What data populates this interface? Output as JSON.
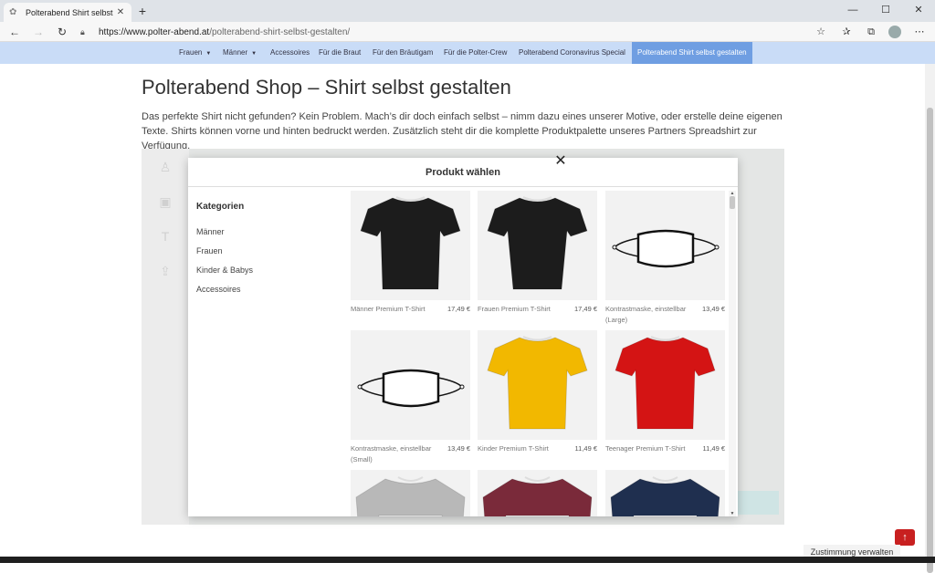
{
  "browser": {
    "tab_title": "Polterabend Shirt selbst gestalten",
    "new_tab": "+",
    "url_domain": "https://www.polter-abend.at",
    "url_path": "/polterabend-shirt-selbst-gestalten/"
  },
  "sitenav": {
    "items": [
      "Frauen",
      "Männer",
      "Accessoires",
      "Für die Braut",
      "Für den Bräutigam",
      "Für die Polter-Crew",
      "Polterabend Coronavirus Special",
      "Polterabend Shirt selbst gestalten"
    ]
  },
  "page": {
    "title": "Polterabend Shop – Shirt selbst gestalten",
    "intro": "Das perfekte Shirt nicht gefunden? Kein Problem. Mach’s dir doch einfach selbst – nimm dazu eines unserer Motive, oder erstelle deine eigenen Texte. Shirts können vorne und hinten bedruckt werden. Zusätzlich steht dir die komplette Produktpalette unseres Partners Spreadshirt zur Verfügung."
  },
  "modal": {
    "title": "Produkt wählen",
    "categories_heading": "Kategorien",
    "categories": [
      "Männer",
      "Frauen",
      "Kinder & Babys",
      "Accessoires"
    ],
    "products": [
      {
        "name": "Männer Premium T-Shirt",
        "price": "17,49 €",
        "kind": "tshirt",
        "color": "#1c1c1c"
      },
      {
        "name": "Frauen Premium T-Shirt",
        "price": "17,49 €",
        "kind": "tshirt-women",
        "color": "#1c1c1c"
      },
      {
        "name": "Kontrastmaske, einstellbar (Large)",
        "price": "13,49 €",
        "kind": "mask",
        "color": "#ffffff"
      },
      {
        "name": "Kontrastmaske, einstellbar (Small)",
        "price": "13,49 €",
        "kind": "mask",
        "color": "#ffffff"
      },
      {
        "name": "Kinder Premium T-Shirt",
        "price": "11,49 €",
        "kind": "tshirt",
        "color": "#f2b800"
      },
      {
        "name": "Teenager Premium T-Shirt",
        "price": "11,49 €",
        "kind": "tshirt",
        "color": "#d41414"
      },
      {
        "name": "",
        "price": "",
        "kind": "tshirt-long",
        "color": "#b8b8b8"
      },
      {
        "name": "",
        "price": "",
        "kind": "tshirt-long",
        "color": "#7a2a3a"
      },
      {
        "name": "",
        "price": "",
        "kind": "tshirt-long",
        "color": "#1f2f4f"
      }
    ]
  },
  "footer": {
    "consent": "Zustimmung verwalten"
  },
  "icons": {
    "back": "back-arrow-icon",
    "forward": "forward-arrow-icon",
    "reload": "reload-icon",
    "lock": "lock-icon",
    "star": "star-icon",
    "favorites": "favorites-icon",
    "collections": "collections-icon",
    "menu": "more-icon",
    "close": "close-icon",
    "totop": "arrow-up-icon"
  }
}
